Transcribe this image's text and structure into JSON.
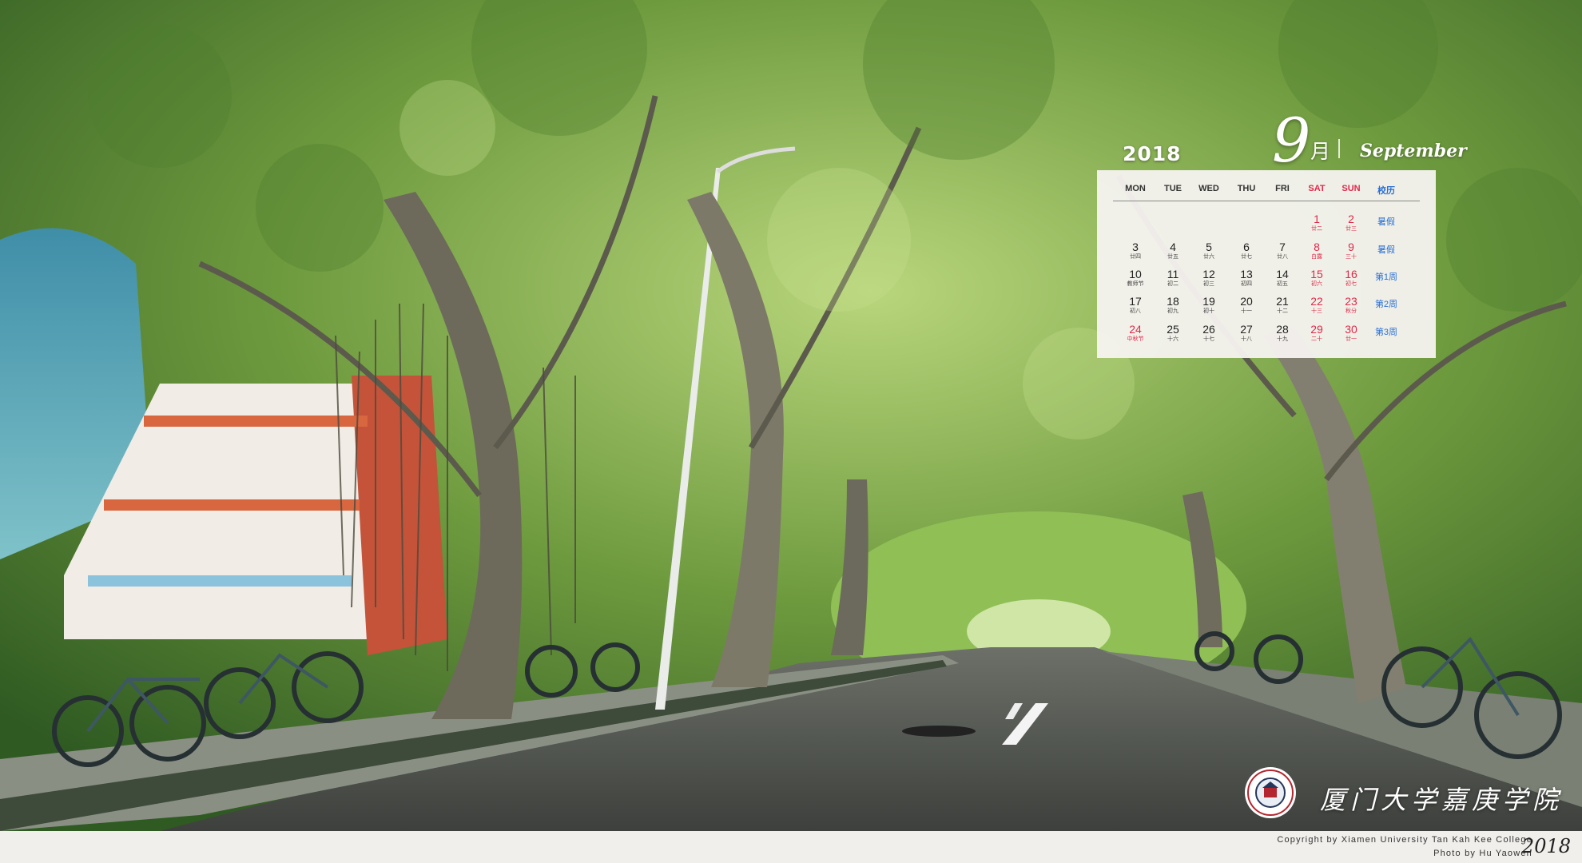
{
  "calendar": {
    "year": "2018",
    "month_number": "9",
    "month_cn": "月",
    "month_en": "September",
    "headers": [
      "MON",
      "TUE",
      "WED",
      "THU",
      "FRI",
      "SAT",
      "SUN",
      "校历"
    ],
    "rows": [
      {
        "days": [
          null,
          null,
          null,
          null,
          null,
          {
            "d": "1",
            "l": "廿二"
          },
          {
            "d": "2",
            "l": "廿三"
          }
        ],
        "week": "暑假"
      },
      {
        "days": [
          {
            "d": "3",
            "l": "廿四"
          },
          {
            "d": "4",
            "l": "廿五"
          },
          {
            "d": "5",
            "l": "廿六"
          },
          {
            "d": "6",
            "l": "廿七"
          },
          {
            "d": "7",
            "l": "廿八"
          },
          {
            "d": "8",
            "l": "白露"
          },
          {
            "d": "9",
            "l": "三十"
          }
        ],
        "week": "暑假"
      },
      {
        "days": [
          {
            "d": "10",
            "l": "教师节"
          },
          {
            "d": "11",
            "l": "初二"
          },
          {
            "d": "12",
            "l": "初三"
          },
          {
            "d": "13",
            "l": "初四"
          },
          {
            "d": "14",
            "l": "初五"
          },
          {
            "d": "15",
            "l": "初六"
          },
          {
            "d": "16",
            "l": "初七"
          }
        ],
        "week": "第1周"
      },
      {
        "days": [
          {
            "d": "17",
            "l": "初八"
          },
          {
            "d": "18",
            "l": "初九"
          },
          {
            "d": "19",
            "l": "初十"
          },
          {
            "d": "20",
            "l": "十一"
          },
          {
            "d": "21",
            "l": "十二"
          },
          {
            "d": "22",
            "l": "十三"
          },
          {
            "d": "23",
            "l": "秋分"
          }
        ],
        "week": "第2周"
      },
      {
        "days": [
          {
            "d": "24",
            "l": "中秋节",
            "red": true
          },
          {
            "d": "25",
            "l": "十六"
          },
          {
            "d": "26",
            "l": "十七"
          },
          {
            "d": "27",
            "l": "十八"
          },
          {
            "d": "28",
            "l": "十九"
          },
          {
            "d": "29",
            "l": "二十"
          },
          {
            "d": "30",
            "l": "廿一"
          }
        ],
        "week": "第3周"
      }
    ]
  },
  "logo": {
    "text": "厦门大学嘉庚学院"
  },
  "footer": {
    "copyright": "Copyright  by  Xiamen  University  Tan  Kah  Kee  College",
    "photo": "Photo  by  Hu  Yaowen",
    "year": "2018"
  },
  "colors": {
    "weekend": "#e0284a",
    "school_calendar": "#2a6fd6",
    "panel": "#f6f3f0"
  }
}
